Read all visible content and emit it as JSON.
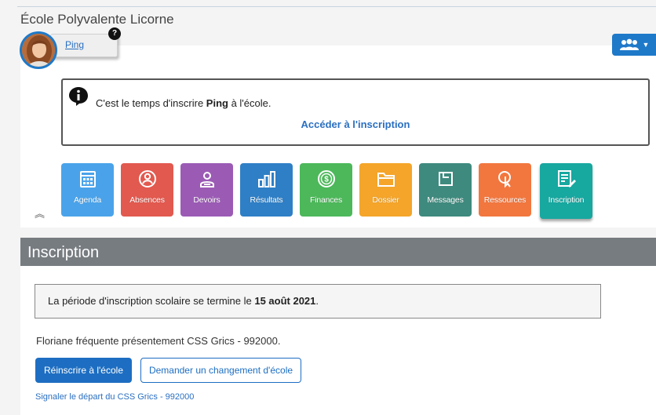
{
  "header": {
    "school_name": "École Polyvalente Licorne",
    "student_name": "Ping",
    "help_badge": "?"
  },
  "notice": {
    "text_before": "C'est le temps d'inscrire ",
    "student_bold": "Ping",
    "text_after": " à l'école.",
    "link_label": "Accéder à l'inscription"
  },
  "tiles": [
    {
      "label": "Agenda",
      "color": "#4aa3ea",
      "icon": "calendar-icon"
    },
    {
      "label": "Absences",
      "color": "#e2594f",
      "icon": "person-icon"
    },
    {
      "label": "Devoirs",
      "color": "#9b5bb5",
      "icon": "student-icon"
    },
    {
      "label": "Résultats",
      "color": "#2f7fc6",
      "icon": "bar-chart-icon"
    },
    {
      "label": "Finances",
      "color": "#4cb85a",
      "icon": "dollar-icon"
    },
    {
      "label": "Dossier",
      "color": "#f4a52a",
      "icon": "folder-icon"
    },
    {
      "label": "Messages",
      "color": "#3f8a7e",
      "icon": "message-icon"
    },
    {
      "label": "Ressources",
      "color": "#f2773f",
      "icon": "resource-icon"
    },
    {
      "label": "Inscription",
      "color": "#17a8a0",
      "icon": "form-edit-icon"
    }
  ],
  "section": {
    "title": "Inscription",
    "period_text": "La période d'inscription scolaire se termine le ",
    "period_date": "15 août 2021",
    "period_end": ".",
    "frequentation": "Floriane fréquente présentement CSS Grics - 992000.",
    "reinscribe_label": "Réinscrire à l'école",
    "change_school_label": "Demander un changement d'école",
    "depart_link": "Signaler le départ du CSS Grics - 992000"
  },
  "colors": {
    "brand_blue": "#1e79c9",
    "section_bar": "#777c81"
  }
}
